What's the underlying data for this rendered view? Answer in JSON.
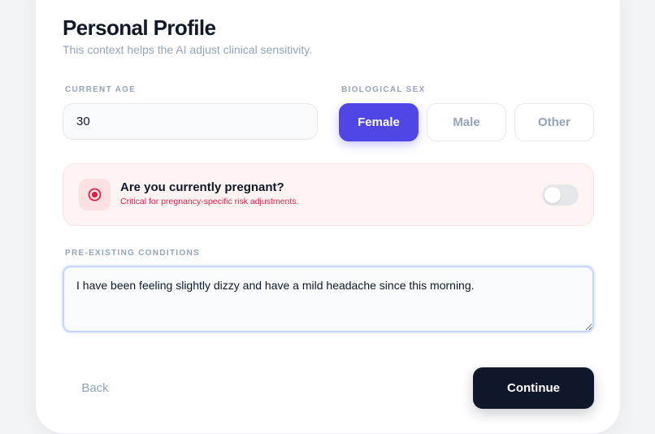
{
  "header": {
    "title": "Personal Profile",
    "subtitle": "This context helps the AI adjust clinical sensitivity."
  },
  "age": {
    "label": "CURRENT AGE",
    "value": "30"
  },
  "sex": {
    "label": "BIOLOGICAL SEX",
    "options": [
      "Female",
      "Male",
      "Other"
    ],
    "selected": "Female"
  },
  "pregnancy": {
    "icon": "radio-target-icon",
    "question": "Are you currently pregnant?",
    "note": "Critical for pregnancy-specific risk adjustments.",
    "toggle_on": false
  },
  "conditions": {
    "label": "PRE-EXISTING CONDITIONS",
    "value": "I have been feeling slightly dizzy and have a mild headache since this morning."
  },
  "actions": {
    "back_label": "Back",
    "continue_label": "Continue"
  },
  "colors": {
    "accent": "#5046e5",
    "primary_dark": "#0f172a",
    "alert": "#e11d48"
  }
}
